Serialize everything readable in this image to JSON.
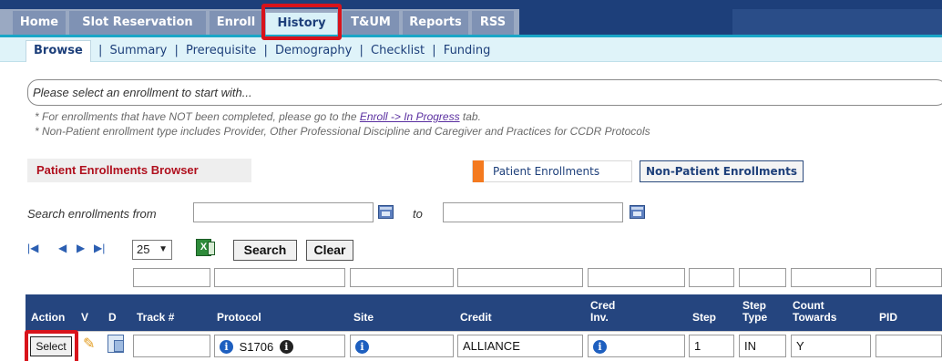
{
  "topnav": {
    "tabs": [
      {
        "label": "Home"
      },
      {
        "label": "Slot Reservation"
      },
      {
        "label": "Enroll"
      },
      {
        "label": "History"
      },
      {
        "label": "T&UM"
      },
      {
        "label": "Reports"
      },
      {
        "label": "RSS"
      }
    ],
    "active_tab": "History",
    "highlight_color": "#d8131b"
  },
  "subnav": {
    "items": [
      "Browse",
      "Summary",
      "Prerequisite",
      "Demography",
      "Checklist",
      "Funding"
    ],
    "active": "Browse",
    "separator": "|"
  },
  "enrollment_select": {
    "placeholder": "Please select an enrollment to start with..."
  },
  "notes": {
    "line1_prefix": "* For enrollments that have NOT been completed, please go to the ",
    "line1_link": "Enroll -> In Progress",
    "line1_suffix": " tab.",
    "line2": "* Non-Patient enrollment type includes Provider, Other Professional Discipline and Caregiver and Practices for CCDR Protocols"
  },
  "browser": {
    "title": "Patient Enrollments Browser",
    "patient_button": "Patient Enrollments",
    "nonpatient_button": "Non-Patient Enrollments"
  },
  "search": {
    "from_label": "Search enrollments from",
    "to_label": "to",
    "from_value": "",
    "to_value": ""
  },
  "pager": {
    "first_icon": "first-page-icon",
    "prev_icon": "prev-page-icon",
    "next_icon": "next-page-icon",
    "last_icon": "last-page-icon",
    "page_size": "25",
    "search_button": "Search",
    "clear_button": "Clear"
  },
  "table": {
    "headers": {
      "action": "Action",
      "v": "V",
      "d": "D",
      "track": "Track #",
      "protocol": "Protocol",
      "site": "Site",
      "credit": "Credit",
      "cred_inv_1": "Cred",
      "cred_inv_2": "Inv.",
      "step": "Step",
      "step_type_1": "Step",
      "step_type_2": "Type",
      "count_towards_1": "Count",
      "count_towards_2": "Towards",
      "pid": "PID"
    },
    "rows": [
      {
        "action": "Select",
        "track": "",
        "protocol": "S1706",
        "credit": "ALLIANCE",
        "step": "1",
        "step_type": "IN",
        "count_towards": "Y",
        "pid": ""
      }
    ]
  },
  "colors": {
    "nav_dark": "#1d3f7a",
    "subnav_bg": "#dff3f9",
    "title_red": "#b0101e",
    "accent_orange": "#f47a1f",
    "table_header": "#25457f"
  }
}
